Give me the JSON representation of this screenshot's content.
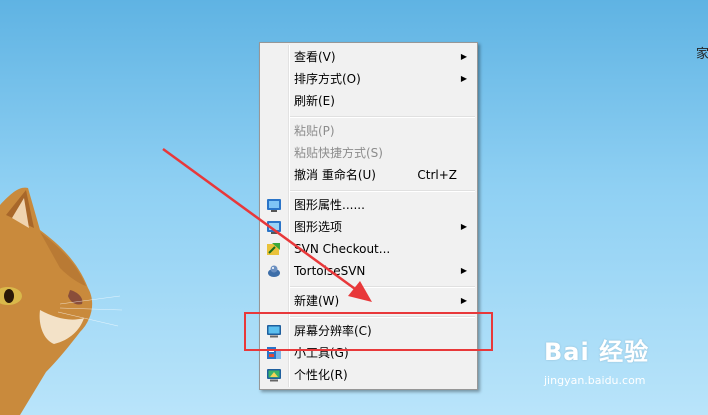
{
  "desktop": {
    "edge_text": "家"
  },
  "context_menu": {
    "items": [
      {
        "label": "查看(V)",
        "has_submenu": true
      },
      {
        "label": "排序方式(O)",
        "has_submenu": true
      },
      {
        "label": "刷新(E)"
      },
      {
        "label": "粘贴(P)",
        "disabled": true
      },
      {
        "label": "粘贴快捷方式(S)",
        "disabled": true
      },
      {
        "label": "撤消 重命名(U)",
        "shortcut": "Ctrl+Z"
      },
      {
        "label": "图形属性......",
        "icon": "graphics-properties-icon"
      },
      {
        "label": "图形选项",
        "icon": "graphics-options-icon",
        "has_submenu": true
      },
      {
        "label": "SVN Checkout...",
        "icon": "svn-checkout-icon"
      },
      {
        "label": "TortoiseSVN",
        "icon": "tortoisesvn-icon",
        "has_submenu": true
      },
      {
        "label": "新建(W)",
        "has_submenu": true
      },
      {
        "label": "屏幕分辨率(C)",
        "icon": "screen-resolution-icon"
      },
      {
        "label": "小工具(G)",
        "icon": "gadgets-icon"
      },
      {
        "label": "个性化(R)",
        "icon": "personalize-icon"
      }
    ]
  },
  "annotation": {
    "color": "#e8383a"
  },
  "watermark": {
    "brand": "Bai 经验",
    "url": "jingyan.baidu.com"
  }
}
